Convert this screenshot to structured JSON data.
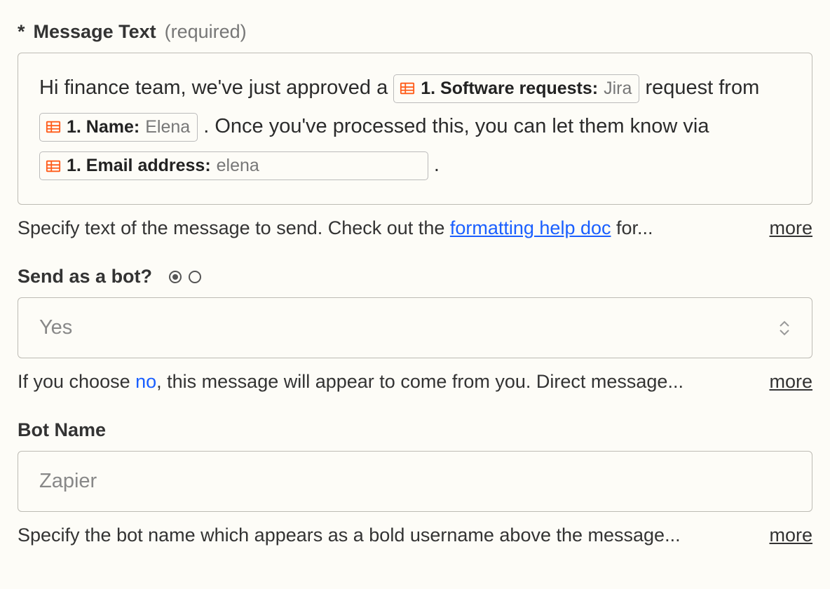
{
  "message_text": {
    "required_star": "*",
    "label": "Message Text",
    "required_hint": "(required)",
    "segments": {
      "s1": "Hi finance team, we've just approved a ",
      "token1_label": "1. Software requests:",
      "token1_value": "Jira",
      "s2": " request from ",
      "token2_label": "1. Name:",
      "token2_value": "Elena",
      "s3": ". Once you've processed this, you can let them know via ",
      "token3_label": "1. Email address:",
      "token3_value": "elena",
      "s4": " ."
    },
    "help_prefix": "Specify text of the message to send. Check out the ",
    "help_link": "formatting help doc",
    "help_suffix": " for...",
    "more": "more"
  },
  "send_as_bot": {
    "label": "Send as a bot?",
    "value": "Yes",
    "help_prefix": "If you choose ",
    "help_link": "no",
    "help_suffix": ", this message will appear to come from you. Direct message...",
    "more": "more"
  },
  "bot_name": {
    "label": "Bot Name",
    "placeholder": "Zapier",
    "help": "Specify the bot name which appears as a bold username above the message...",
    "more": "more"
  }
}
